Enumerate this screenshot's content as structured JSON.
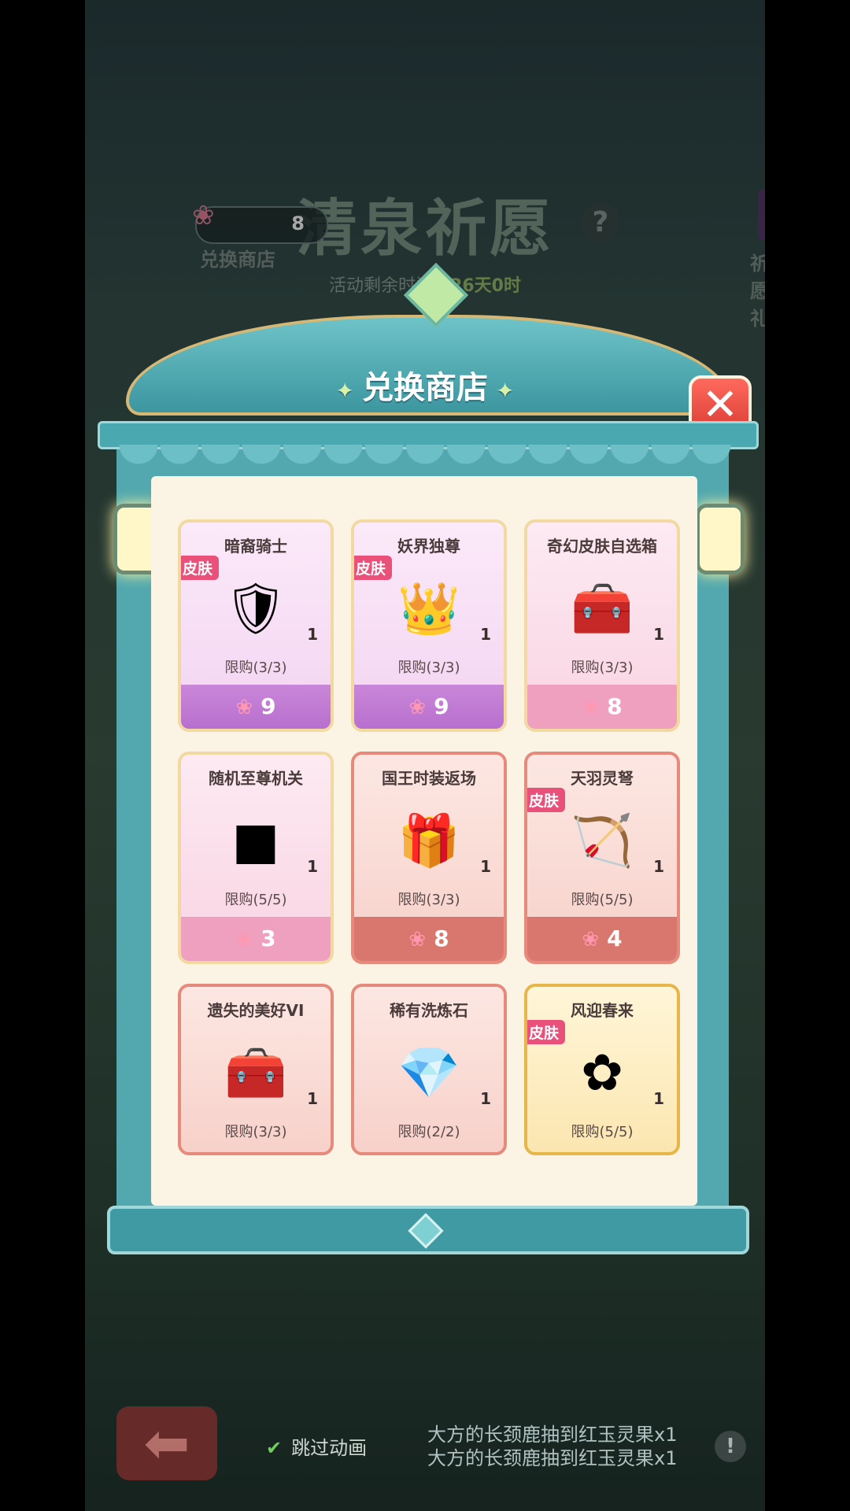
{
  "background": {
    "title": "清泉祈愿",
    "help": "?",
    "timer_label": "活动剩余时间：",
    "timer_value": "26天0时",
    "currency_count": "8",
    "exchange_label": "兑换商店",
    "gift_label": "祈愿礼"
  },
  "dialog": {
    "title": "兑换商店",
    "close": "✕"
  },
  "items": [
    {
      "name": "暗裔骑士",
      "tag": "皮肤",
      "qty": "1",
      "limit": "限购(3/3)",
      "price": "9",
      "icon": "knight-icon",
      "style": "purple"
    },
    {
      "name": "妖界独尊",
      "tag": "皮肤",
      "qty": "1",
      "limit": "限购(3/3)",
      "price": "9",
      "icon": "demon-king-icon",
      "style": "purple"
    },
    {
      "name": "奇幻皮肤自选箱",
      "tag": "",
      "qty": "1",
      "limit": "限购(3/3)",
      "price": "8",
      "icon": "chest-icon",
      "style": "pink"
    },
    {
      "name": "随机至尊机关",
      "tag": "",
      "qty": "1",
      "limit": "限购(5/5)",
      "price": "3",
      "icon": "cube-icon",
      "style": "pink"
    },
    {
      "name": "国王时装返场",
      "tag": "",
      "qty": "1",
      "limit": "限购(3/3)",
      "price": "8",
      "icon": "gold-box-icon",
      "style": "red"
    },
    {
      "name": "天羽灵弩",
      "tag": "皮肤",
      "qty": "1",
      "limit": "限购(5/5)",
      "price": "4",
      "icon": "crossbow-icon",
      "style": "red"
    },
    {
      "name": "遗失的美好VI",
      "tag": "",
      "qty": "1",
      "limit": "限购(3/3)",
      "price": "",
      "icon": "treasure-chest-icon",
      "style": "red"
    },
    {
      "name": "稀有洗炼石",
      "tag": "",
      "qty": "1",
      "limit": "限购(2/2)",
      "price": "",
      "icon": "crystal-icon",
      "style": "red"
    },
    {
      "name": "风迎春来",
      "tag": "皮肤",
      "qty": "1",
      "limit": "限购(5/5)",
      "price": "",
      "icon": "pinwheel-icon",
      "style": "gold"
    }
  ],
  "footer": {
    "skip_label": "跳过动画",
    "message_line1": "大方的长颈鹿抽到红玉灵果x1",
    "message_line2": "大方的长颈鹿抽到红玉灵果x1"
  },
  "colors": {
    "accent": "#4aa8b0",
    "price_purple": "#b86fcf",
    "price_red": "#d9776f",
    "tag": "#e9507a"
  }
}
